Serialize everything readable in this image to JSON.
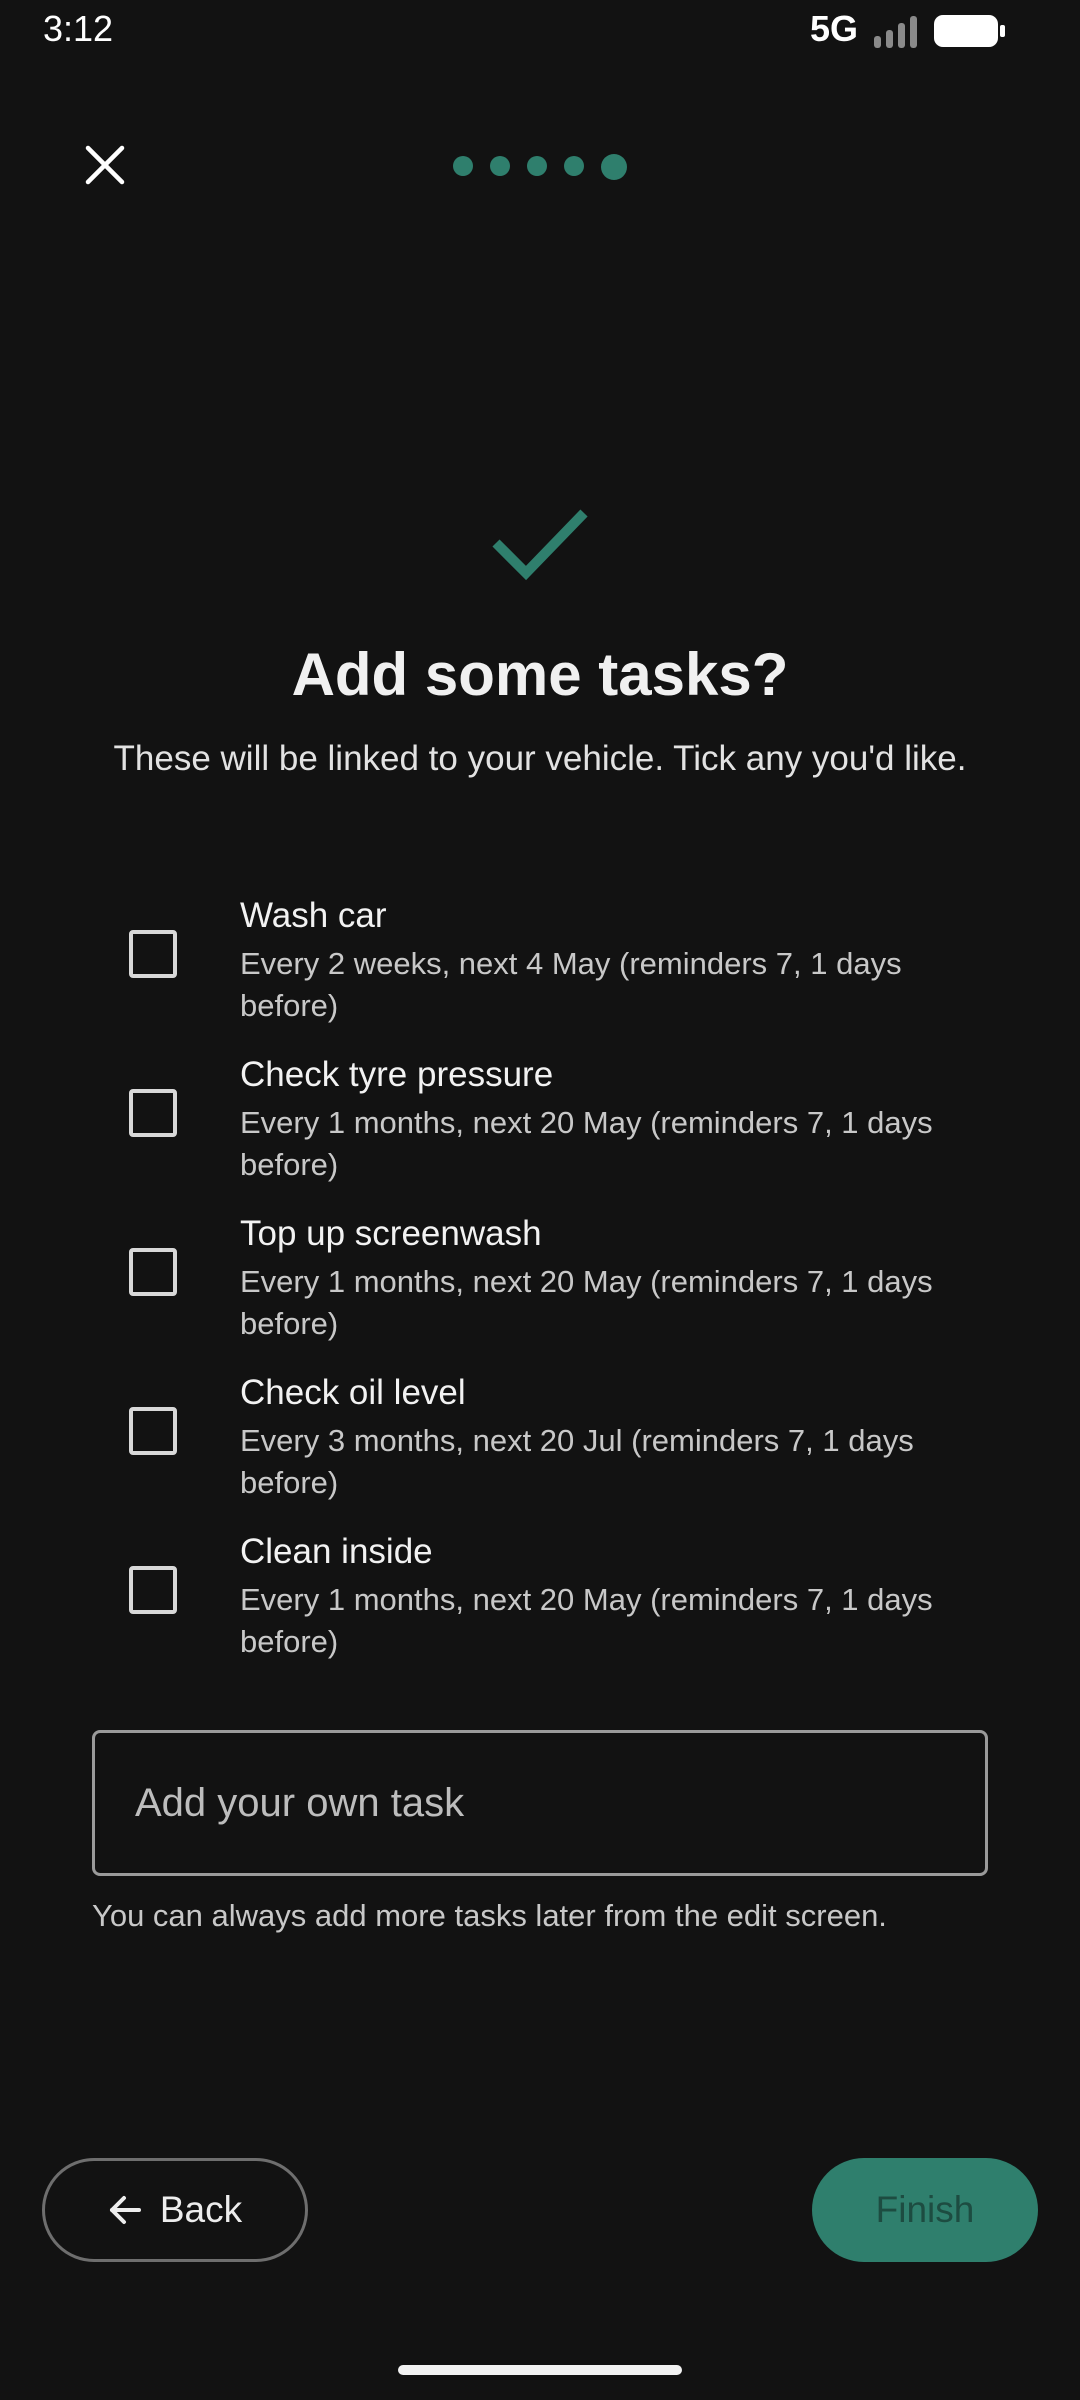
{
  "status_bar": {
    "time": "3:12",
    "network": "5G",
    "signal_icon": "signal-bars-icon",
    "battery_icon": "battery-icon"
  },
  "header": {
    "close_icon": "close-icon",
    "progress_step": 5,
    "progress_total": 5
  },
  "colors": {
    "accent": "#2F7F6D",
    "accent_text": "#1D4C41",
    "background": "#121212"
  },
  "main": {
    "check_icon": "checkmark-icon",
    "title": "Add some tasks?",
    "subtitle": "These will be linked to your vehicle. Tick any you'd like.",
    "tasks": [
      {
        "title": "Wash car",
        "description": "Every 2 weeks, next 4 May (reminders 7, 1 days before)",
        "checked": false
      },
      {
        "title": "Check tyre pressure",
        "description": "Every 1 months, next 20 May (reminders 7, 1 days before)",
        "checked": false
      },
      {
        "title": "Top up screenwash",
        "description": "Every 1 months, next 20 May (reminders 7, 1 days before)",
        "checked": false
      },
      {
        "title": "Check oil level",
        "description": "Every 3 months, next 20 Jul (reminders 7, 1 days before)",
        "checked": false
      },
      {
        "title": "Clean inside",
        "description": "Every 1 months, next 20 May (reminders 7, 1 days before)",
        "checked": false
      }
    ],
    "own_task_placeholder": "Add your own task",
    "own_task_value": "",
    "hint": "You can always add more tasks later from the edit screen."
  },
  "footer": {
    "back_label": "Back",
    "back_icon": "arrow-left-icon",
    "finish_label": "Finish"
  }
}
